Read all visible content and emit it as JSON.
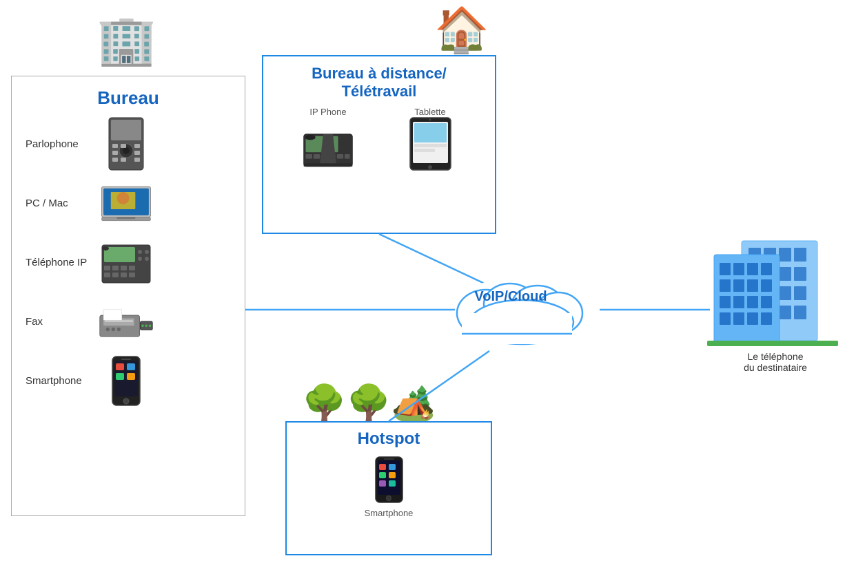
{
  "bureau": {
    "title": "Bureau",
    "items": [
      {
        "label": "Parlophone",
        "icon": "parlophone"
      },
      {
        "label": "PC / Mac",
        "icon": "pc"
      },
      {
        "label": "Téléphone IP",
        "icon": "telip"
      },
      {
        "label": "Fax",
        "icon": "fax"
      },
      {
        "label": "Smartphone",
        "icon": "smartphone"
      }
    ]
  },
  "remote": {
    "title_line1": "Bureau à distance/",
    "title_line2": "Télétravail",
    "items": [
      {
        "label": "IP Phone",
        "icon": "ipphone"
      },
      {
        "label": "Tablette",
        "icon": "tablette"
      }
    ]
  },
  "hotspot": {
    "title": "Hotspot",
    "items": [
      {
        "label": "Smartphone",
        "icon": "smartphone"
      }
    ]
  },
  "voip": {
    "label": "VoIP/Cloud"
  },
  "destination": {
    "label_line1": "Le téléphone",
    "label_line2": "du destinataire"
  }
}
